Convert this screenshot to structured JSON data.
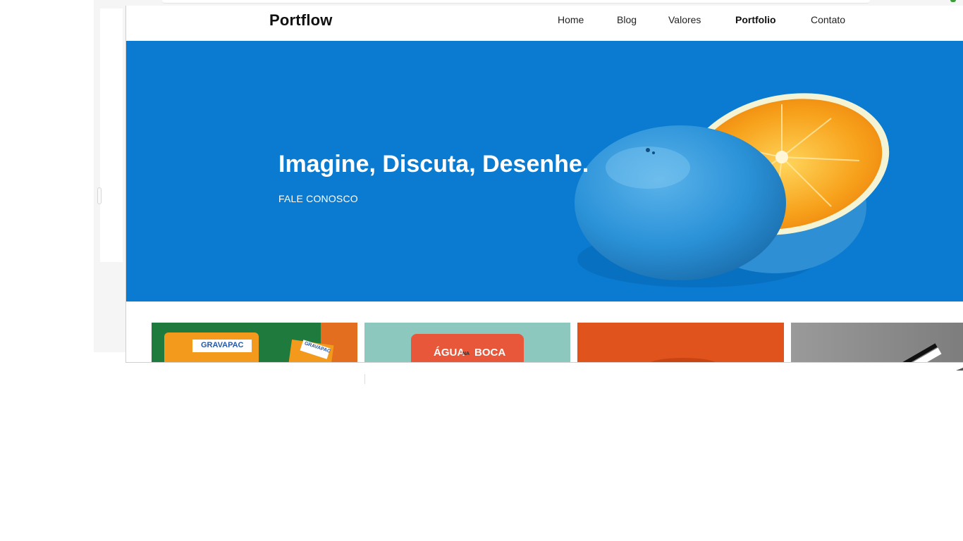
{
  "site": {
    "brand": "Portflow",
    "nav": [
      {
        "label": "Home",
        "active": false
      },
      {
        "label": "Blog",
        "active": false
      },
      {
        "label": "Valores",
        "active": false
      },
      {
        "label": "Portfolio",
        "active": true
      },
      {
        "label": "Contato",
        "active": false
      }
    ]
  },
  "hero": {
    "title": "Imagine, Discuta, Desenhe.",
    "cta": "FALE CONOSCO",
    "background_color": "#0a7bd0",
    "image": "blue-orange-fruit-illustration"
  },
  "portfolio": {
    "cards": [
      {
        "label": "GRAVAPAC",
        "secondary_label": "GRAVAPAC",
        "background_color": "#1f7a3e"
      },
      {
        "label": "ÁGUA",
        "label_small": "NA",
        "label_end": "BOCA",
        "background_color": "#8dc8bf"
      },
      {
        "label": "",
        "background_color": "#e0531c"
      },
      {
        "label": "",
        "background_color": "#8e8e8e"
      }
    ]
  },
  "colors": {
    "accent_blue": "#0a7bd0",
    "orange": "#f39a1d",
    "text_dark": "#111111"
  }
}
